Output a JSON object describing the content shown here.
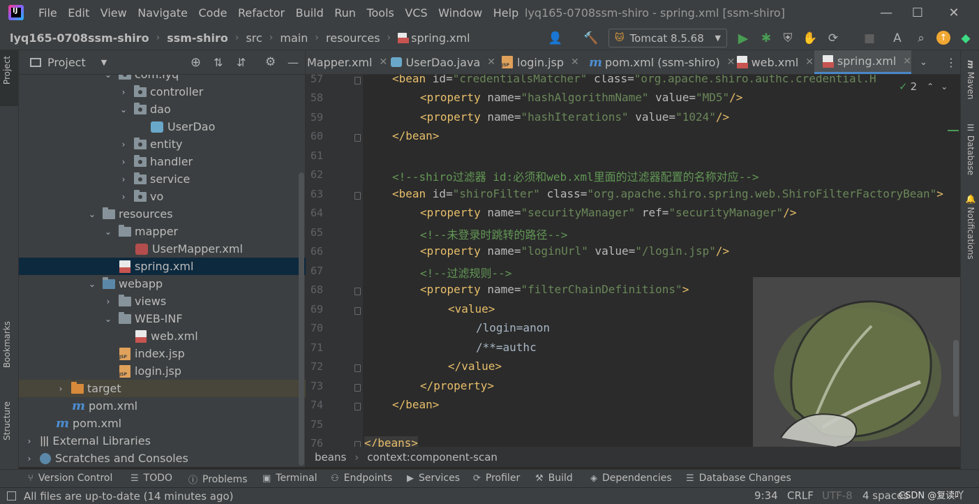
{
  "app": {
    "window_title": "lyq165-0708ssm-shiro - spring.xml [ssm-shiro]",
    "menu": [
      "File",
      "Edit",
      "View",
      "Navigate",
      "Code",
      "Refactor",
      "Build",
      "Run",
      "Tools",
      "VCS",
      "Window",
      "Help"
    ]
  },
  "navbar": {
    "crumbs": [
      "lyq165-0708ssm-shiro",
      "ssm-shiro",
      "src",
      "main",
      "resources",
      "spring.xml"
    ],
    "run_config": "Tomcat 8.5.68"
  },
  "project_panel": {
    "title": "Project",
    "tree": [
      {
        "label": "com.lyq"
      },
      {
        "label": "controller"
      },
      {
        "label": "dao"
      },
      {
        "label": "UserDao"
      },
      {
        "label": "entity"
      },
      {
        "label": "handler"
      },
      {
        "label": "service"
      },
      {
        "label": "vo"
      },
      {
        "label": "resources"
      },
      {
        "label": "mapper"
      },
      {
        "label": "UserMapper.xml"
      },
      {
        "label": "spring.xml"
      },
      {
        "label": "webapp"
      },
      {
        "label": "views"
      },
      {
        "label": "WEB-INF"
      },
      {
        "label": "web.xml"
      },
      {
        "label": "index.jsp"
      },
      {
        "label": "login.jsp"
      },
      {
        "label": "target"
      },
      {
        "label": "pom.xml"
      },
      {
        "label": "pom.xml"
      },
      {
        "label": "External Libraries"
      },
      {
        "label": "Scratches and Consoles"
      }
    ]
  },
  "editor_tabs": [
    "Mapper.xml",
    "UserDao.java",
    "login.jsp",
    "pom.xml (ssm-shiro)",
    "web.xml",
    "spring.xml"
  ],
  "editor": {
    "line_numbers": [
      "57",
      "58",
      "59",
      "60",
      "61",
      "62",
      "63",
      "64",
      "65",
      "66",
      "67",
      "68",
      "69",
      "70",
      "71",
      "72",
      "73",
      "74",
      "75",
      "76"
    ],
    "inspection_count": "2",
    "crumbs": [
      "beans",
      "context:component-scan"
    ]
  },
  "left_stripe": {
    "project": "Project",
    "bookmarks": "Bookmarks",
    "structure": "Structure"
  },
  "right_stripe": {
    "maven": "Maven",
    "database": "Database",
    "notifications": "Notifications"
  },
  "bottom_tools": [
    "Version Control",
    "TODO",
    "Problems",
    "Terminal",
    "Endpoints",
    "Services",
    "Profiler",
    "Build",
    "Dependencies",
    "Database Changes"
  ],
  "status": {
    "message": "All files are up-to-date (14 minutes ago)",
    "position": "9:34",
    "line_sep": "CRLF",
    "encoding": "UTF-8",
    "indent": "4 spaces",
    "watermark": "CSDN @复读吖"
  }
}
